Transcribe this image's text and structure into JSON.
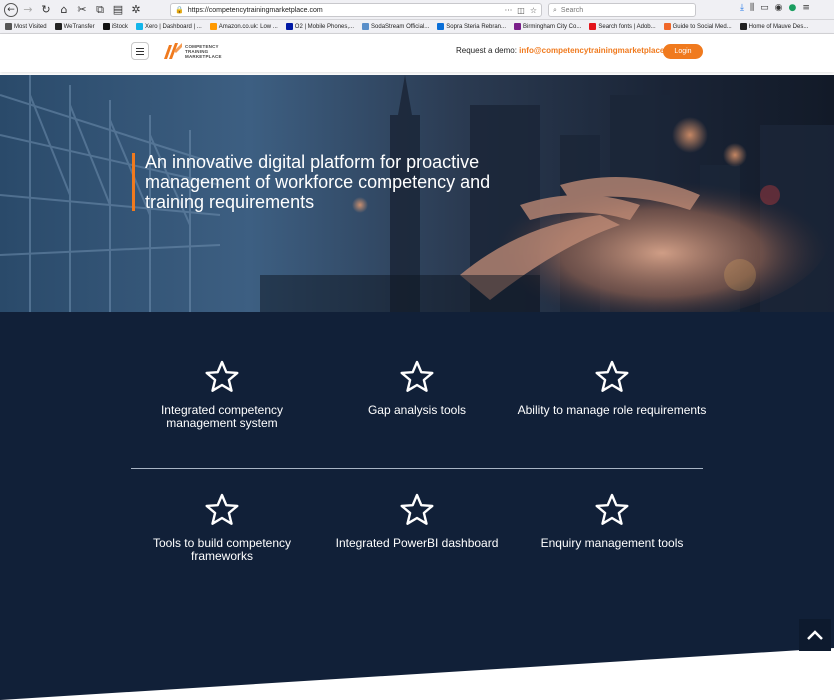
{
  "browser": {
    "url": "https://competencytrainingmarketplace.com",
    "search_placeholder": "Search"
  },
  "bookmarks": [
    {
      "label": "Most Visited",
      "color": "#555555"
    },
    {
      "label": "WeTransfer",
      "color": "#222222"
    },
    {
      "label": "iStock",
      "color": "#111111"
    },
    {
      "label": "Xero | Dashboard | ...",
      "color": "#13b5ea"
    },
    {
      "label": "Amazon.co.uk: Low ...",
      "color": "#ff9900"
    },
    {
      "label": "O2 | Mobile Phones,...",
      "color": "#0019a5"
    },
    {
      "label": "SodaStream Official...",
      "color": "#5a8fc9"
    },
    {
      "label": "Sopra Steria Rebran...",
      "color": "#0a6fd8"
    },
    {
      "label": "Birmingham City Co...",
      "color": "#7a1f8a"
    },
    {
      "label": "Search fonts | Adob...",
      "color": "#e3141b"
    },
    {
      "label": "Guide to Social Med...",
      "color": "#f0682a"
    },
    {
      "label": "Home of Mauve Des...",
      "color": "#222222"
    }
  ],
  "header": {
    "logo_lines": [
      "COMPETENCY",
      "TRAINING",
      "MARKETPLACE"
    ],
    "demo_label": "Request a demo:",
    "demo_email": "info@competencytrainingmarketplace.com",
    "login_label": "Login",
    "accent_color": "#f07a1e"
  },
  "hero": {
    "title": "An innovative digital platform for proactive management of workforce competency and training requirements"
  },
  "features": [
    {
      "label": "Integrated competency management system",
      "icon": "star-icon"
    },
    {
      "label": "Gap analysis tools",
      "icon": "star-icon"
    },
    {
      "label": "Ability to manage role requirements",
      "icon": "star-icon"
    },
    {
      "label": "Tools to build competency frameworks",
      "icon": "star-icon"
    },
    {
      "label": "Integrated PowerBI dashboard",
      "icon": "star-icon"
    },
    {
      "label": "Enquiry management tools",
      "icon": "star-icon"
    }
  ],
  "colors": {
    "features_bg": "#112038",
    "accent": "#f07a1e"
  }
}
